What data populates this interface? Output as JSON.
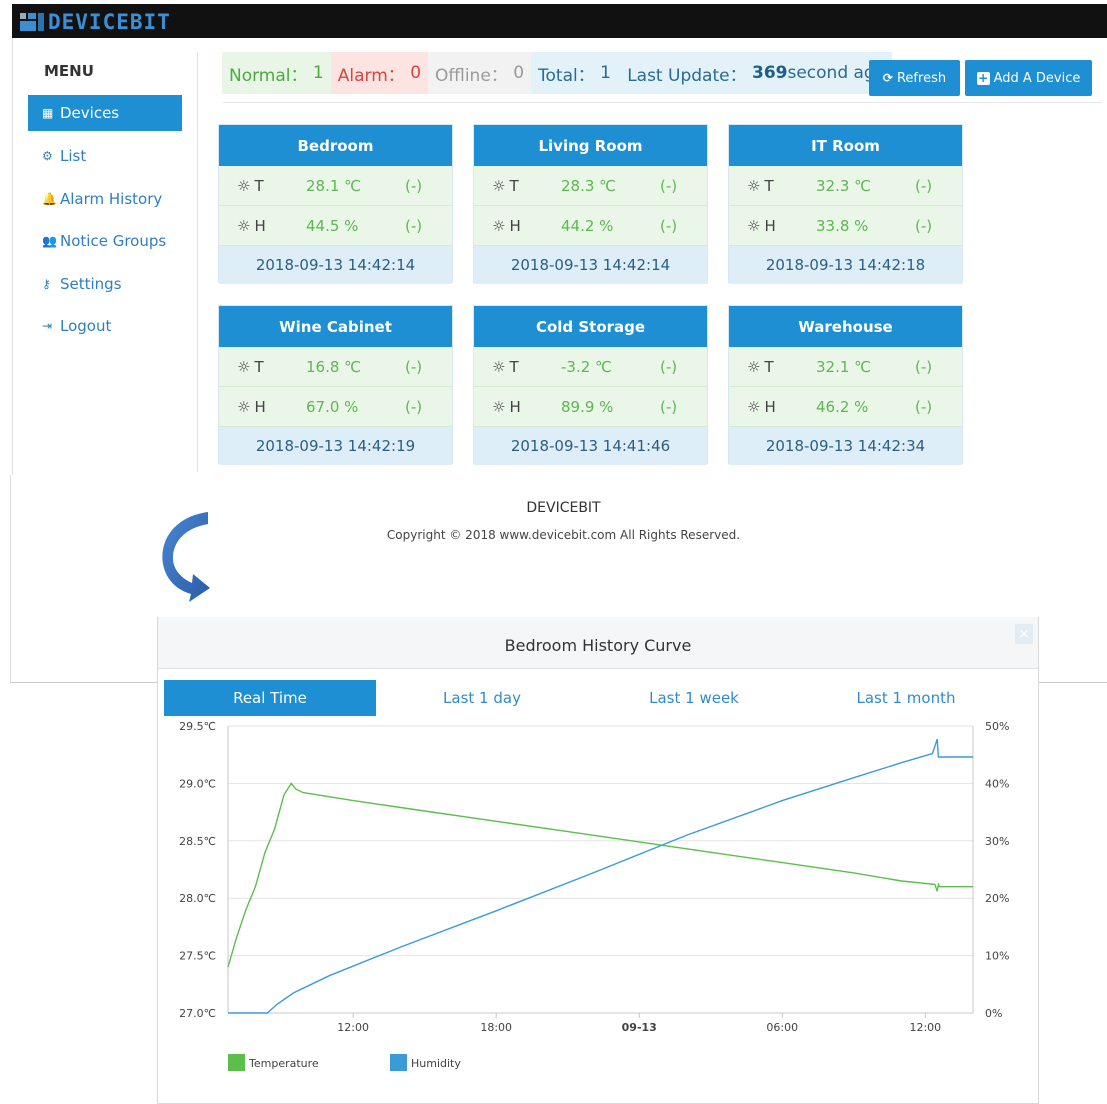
{
  "brand": {
    "name": "DEVICEBIT"
  },
  "sidebar": {
    "title": "MENU",
    "items": [
      {
        "icon": "grid-icon",
        "glyph": "▦",
        "label": "Devices",
        "active": true
      },
      {
        "icon": "cogs-icon",
        "glyph": "⚙",
        "label": "List",
        "active": false
      },
      {
        "icon": "bell-icon",
        "glyph": "🔔",
        "label": "Alarm History",
        "active": false
      },
      {
        "icon": "users-icon",
        "glyph": "👥",
        "label": "Notice Groups",
        "active": false
      },
      {
        "icon": "key-icon",
        "glyph": "⚷",
        "label": "Settings",
        "active": false
      },
      {
        "icon": "logout-icon",
        "glyph": "⇥",
        "label": "Logout",
        "active": false
      }
    ]
  },
  "status": {
    "normal_label": "Normal：",
    "normal_count": "1",
    "alarm_label": "Alarm：",
    "alarm_count": "0",
    "offline_label": "Offline：",
    "offline_count": "0",
    "total_label": "Total：",
    "total_count": "1",
    "update_label": "Last Update：",
    "update_value": "369",
    "update_suffix": "second ago"
  },
  "toolbar": {
    "refresh_label": "Refresh",
    "refresh_icon": "refresh-icon",
    "add_label": "Add A Device",
    "add_icon": "plus-square-icon"
  },
  "devices": [
    {
      "name": "Bedroom",
      "t_label": "T",
      "t_value": "28.1 ℃",
      "t_paren": "(-)",
      "h_label": "H",
      "h_value": "44.5 %",
      "h_paren": "(-)",
      "time": "2018-09-13 14:42:14"
    },
    {
      "name": "Living Room",
      "t_label": "T",
      "t_value": "28.3 ℃",
      "t_paren": "(-)",
      "h_label": "H",
      "h_value": "44.2 %",
      "h_paren": "(-)",
      "time": "2018-09-13 14:42:14"
    },
    {
      "name": "IT Room",
      "t_label": "T",
      "t_value": "32.3 ℃",
      "t_paren": "(-)",
      "h_label": "H",
      "h_value": "33.8 %",
      "h_paren": "(-)",
      "time": "2018-09-13 14:42:18"
    },
    {
      "name": "Wine Cabinet",
      "t_label": "T",
      "t_value": "16.8 ℃",
      "t_paren": "(-)",
      "h_label": "H",
      "h_value": "67.0 %",
      "h_paren": "(-)",
      "time": "2018-09-13 14:42:19"
    },
    {
      "name": "Cold Storage",
      "t_label": "T",
      "t_value": "-3.2 ℃",
      "t_paren": "(-)",
      "h_label": "H",
      "h_value": "89.9 %",
      "h_paren": "(-)",
      "time": "2018-09-13 14:41:46"
    },
    {
      "name": "Warehouse",
      "t_label": "T",
      "t_value": "32.1 ℃",
      "t_paren": "(-)",
      "h_label": "H",
      "h_value": "46.2 %",
      "h_paren": "(-)",
      "time": "2018-09-13 14:42:34"
    }
  ],
  "footer": {
    "brand": "DEVICEBIT",
    "copyright": "Copyright © 2018 www.devicebit.com All Rights Reserved."
  },
  "modal": {
    "title": "Bedroom History Curve",
    "close_glyph": "×",
    "tabs": [
      {
        "label": "Real Time",
        "active": true
      },
      {
        "label": "Last 1 day",
        "active": false
      },
      {
        "label": "Last 1 week",
        "active": false
      },
      {
        "label": "Last 1 month",
        "active": false
      }
    ]
  },
  "colors": {
    "accent": "#1f8fd4",
    "temperature": "#5cbf4c",
    "humidity": "#3a9bd6"
  },
  "chart_data": {
    "type": "line",
    "title": "Bedroom History Curve",
    "xlabel": "",
    "x_ticks": [
      {
        "label": "12:00",
        "t": 12,
        "bold": false
      },
      {
        "label": "18:00",
        "t": 18,
        "bold": false
      },
      {
        "label": "09-13",
        "t": 24,
        "bold": true
      },
      {
        "label": "06:00",
        "t": 30,
        "bold": false
      },
      {
        "label": "12:00",
        "t": 36,
        "bold": false
      }
    ],
    "xlim": [
      6.75,
      38.0
    ],
    "y_left": {
      "ticks": [
        "29.5℃",
        "29.0℃",
        "28.5℃",
        "28.0℃",
        "27.5℃",
        "27.0℃"
      ],
      "values": [
        29.5,
        29.0,
        28.5,
        28.0,
        27.5,
        27.0
      ],
      "lim": [
        27.0,
        29.5
      ]
    },
    "y_right": {
      "ticks": [
        "50%",
        "40%",
        "30%",
        "20%",
        "10%",
        "0%"
      ],
      "values": [
        50,
        40,
        30,
        20,
        10,
        0
      ],
      "lim": [
        0,
        50
      ]
    },
    "grid": true,
    "legend": "bottom-left",
    "series": [
      {
        "name": "Temperature",
        "axis": "left",
        "color": "#5cbf4c",
        "x": [
          6.75,
          7.1,
          7.5,
          7.9,
          8.3,
          8.7,
          9.1,
          9.4,
          9.6,
          9.9,
          12,
          15,
          18,
          21,
          24,
          27,
          30,
          33,
          35,
          36.4,
          36.5,
          36.55,
          36.6,
          38.0
        ],
        "y": [
          27.4,
          27.65,
          27.9,
          28.1,
          28.4,
          28.6,
          28.9,
          29.0,
          28.95,
          28.92,
          28.85,
          28.76,
          28.67,
          28.58,
          28.49,
          28.4,
          28.31,
          28.22,
          28.15,
          28.12,
          28.06,
          28.12,
          28.1,
          28.1
        ]
      },
      {
        "name": "Humidity",
        "axis": "right",
        "color": "#3a9bd6",
        "x": [
          6.75,
          8.4,
          8.8,
          9.5,
          11,
          14,
          18,
          22,
          26,
          30,
          33,
          35,
          36.3,
          36.5,
          36.55,
          36.6,
          38.0
        ],
        "y": [
          0,
          0,
          1.5,
          3.5,
          6.5,
          11.5,
          17.8,
          24.3,
          31.0,
          37.0,
          41.0,
          43.6,
          45.2,
          47.7,
          44.6,
          44.6,
          44.6
        ]
      }
    ]
  }
}
